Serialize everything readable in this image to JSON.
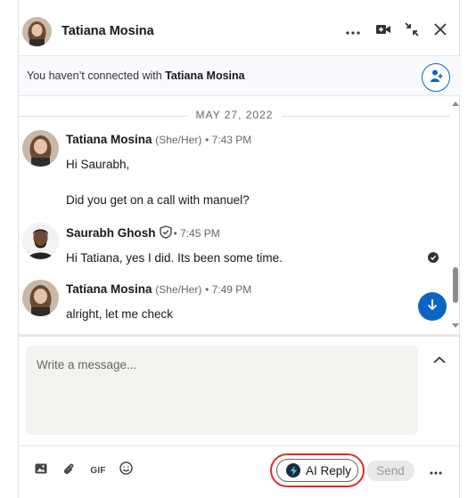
{
  "header": {
    "name": "Tatiana Mosina"
  },
  "banner": {
    "prefix": "You haven’t connected with ",
    "name": "Tatiana Mosina"
  },
  "date_divider": "MAY 27, 2022",
  "messages": [
    {
      "sender": "Tatiana Mosina",
      "pronouns": "(She/Her)",
      "time": "• 7:43 PM",
      "lines": [
        "Hi Saurabh,",
        "Did you get on a call with manuel?"
      ]
    },
    {
      "sender": "Saurabh Ghosh",
      "time": "• 7:45 PM",
      "lines": [
        "Hi Tatiana, yes I did. Its been some time."
      ]
    },
    {
      "sender": "Tatiana Mosina",
      "pronouns": "(She/Her)",
      "time": "• 7:49 PM",
      "lines": [
        "alright, let me check"
      ]
    }
  ],
  "compose": {
    "placeholder": "Write a message..."
  },
  "footer": {
    "gif_label": "GIF",
    "ai_reply_label": "AI Reply",
    "send_label": "Send"
  },
  "colors": {
    "accent": "#0a66c2",
    "highlight_ring": "#e02b2b"
  },
  "icons": [
    "more-icon",
    "video-call-icon",
    "minimize-icon",
    "close-icon",
    "add-connection-icon",
    "verified-shield-icon",
    "read-receipt-icon",
    "scroll-down-icon",
    "expand-up-icon",
    "image-icon",
    "attachment-icon",
    "gif-icon",
    "emoji-icon",
    "ai-spark-icon"
  ]
}
